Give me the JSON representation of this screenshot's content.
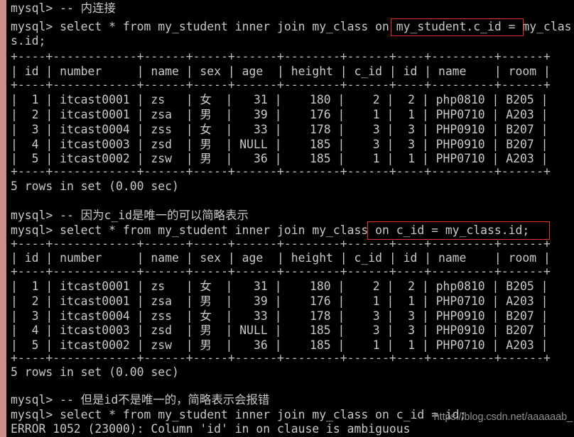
{
  "terminal": {
    "prompt": "mysql>",
    "colors": {
      "background": "#000000",
      "text": "#c9c9c9",
      "gutter": "#cc8e86",
      "highlight_border": "#e8312a",
      "watermark": "#8e8e8e"
    },
    "lines": [
      {
        "id": "l01",
        "text": "mysql> -- 内连接"
      },
      {
        "id": "l02",
        "text": "mysql> select * from my_student inner join my_class on my_student.c_id = my_clas"
      },
      {
        "id": "l03",
        "text": "s.id;"
      },
      {
        "id": "l04",
        "text": "+----+------------+------+-----+------+--------+------+----+---------+------+"
      },
      {
        "id": "l05",
        "text": "| id | number     | name | sex | age  | height | c_id | id | name    | room |"
      },
      {
        "id": "l06",
        "text": "+----+------------+------+-----+------+--------+------+----+---------+------+"
      },
      {
        "id": "l07",
        "text": "|  1 | itcast0001 | zs   | 女  |   31 |    180 |    2 |  2 | php0810 | B205 |"
      },
      {
        "id": "l08",
        "text": "|  2 | itcast0001 | zsa  | 男  |   39 |    176 |    1 |  1 | PHP0710 | A203 |"
      },
      {
        "id": "l09",
        "text": "|  3 | itcast0004 | zss  | 女  |   33 |    178 |    3 |  3 | PHP0910 | B207 |"
      },
      {
        "id": "l10",
        "text": "|  4 | itcast0003 | zsd  | 男  | NULL |    185 |    3 |  3 | PHP0910 | B207 |"
      },
      {
        "id": "l11",
        "text": "|  5 | itcast0002 | zsw  | 男  |   36 |    185 |    1 |  1 | PHP0710 | A203 |"
      },
      {
        "id": "l12",
        "text": "+----+------------+------+-----+------+--------+------+----+---------+------+"
      },
      {
        "id": "l13",
        "text": "5 rows in set (0.00 sec)"
      },
      {
        "id": "l14",
        "text": ""
      },
      {
        "id": "l15",
        "text": "mysql> -- 因为c_id是唯一的可以简略表示"
      },
      {
        "id": "l16",
        "text": "mysql> select * from my_student inner join my_class on c_id = my_class.id;"
      },
      {
        "id": "l17",
        "text": "+----+------------+------+-----+------+--------+------+----+---------+------+"
      },
      {
        "id": "l18",
        "text": "| id | number     | name | sex | age  | height | c_id | id | name    | room |"
      },
      {
        "id": "l19",
        "text": "+----+------------+------+-----+------+--------+------+----+---------+------+"
      },
      {
        "id": "l20",
        "text": "|  1 | itcast0001 | zs   | 女  |   31 |    180 |    2 |  2 | php0810 | B205 |"
      },
      {
        "id": "l21",
        "text": "|  2 | itcast0001 | zsa  | 男  |   39 |    176 |    1 |  1 | PHP0710 | A203 |"
      },
      {
        "id": "l22",
        "text": "|  3 | itcast0004 | zss  | 女  |   33 |    178 |    3 |  3 | PHP0910 | B207 |"
      },
      {
        "id": "l23",
        "text": "|  4 | itcast0003 | zsd  | 男  | NULL |    185 |    3 |  3 | PHP0910 | B207 |"
      },
      {
        "id": "l24",
        "text": "|  5 | itcast0002 | zsw  | 男  |   36 |    185 |    1 |  1 | PHP0710 | A203 |"
      },
      {
        "id": "l25",
        "text": "+----+------------+------+-----+------+--------+------+----+---------+------+"
      },
      {
        "id": "l26",
        "text": "5 rows in set (0.00 sec)"
      },
      {
        "id": "l27",
        "text": ""
      },
      {
        "id": "l28",
        "text": "mysql> -- 但是id不是唯一的，简略表示会报错"
      },
      {
        "id": "l29",
        "text": "mysql> select * from my_student inner join my_class on c_id = id;"
      },
      {
        "id": "l30",
        "text": "ERROR 1052 (23000): Column 'id' in on clause is ambiguous"
      }
    ],
    "highlights": [
      {
        "id": "h1",
        "label": "my_student.c_id"
      },
      {
        "id": "h2",
        "label": "on c_id = my_class.id;"
      }
    ],
    "watermark": "https://blog.csdn.net/aaaaaab_"
  },
  "result_tables": [
    {
      "name": "inner-join-explicit-result",
      "columns": [
        "id",
        "number",
        "name",
        "sex",
        "age",
        "height",
        "c_id",
        "id",
        "name",
        "room"
      ],
      "rows": [
        [
          "1",
          "itcast0001",
          "zs",
          "女",
          "31",
          "180",
          "2",
          "2",
          "php0810",
          "B205"
        ],
        [
          "2",
          "itcast0001",
          "zsa",
          "男",
          "39",
          "176",
          "1",
          "1",
          "PHP0710",
          "A203"
        ],
        [
          "3",
          "itcast0004",
          "zss",
          "女",
          "33",
          "178",
          "3",
          "3",
          "PHP0910",
          "B207"
        ],
        [
          "4",
          "itcast0003",
          "zsd",
          "男",
          "NULL",
          "185",
          "3",
          "3",
          "PHP0910",
          "B207"
        ],
        [
          "5",
          "itcast0002",
          "zsw",
          "男",
          "36",
          "185",
          "1",
          "1",
          "PHP0710",
          "A203"
        ]
      ],
      "status": "5 rows in set (0.00 sec)"
    },
    {
      "name": "inner-join-shorthand-result",
      "columns": [
        "id",
        "number",
        "name",
        "sex",
        "age",
        "height",
        "c_id",
        "id",
        "name",
        "room"
      ],
      "rows": [
        [
          "1",
          "itcast0001",
          "zs",
          "女",
          "31",
          "180",
          "2",
          "2",
          "php0810",
          "B205"
        ],
        [
          "2",
          "itcast0001",
          "zsa",
          "男",
          "39",
          "176",
          "1",
          "1",
          "PHP0710",
          "A203"
        ],
        [
          "3",
          "itcast0004",
          "zss",
          "女",
          "33",
          "178",
          "3",
          "3",
          "PHP0910",
          "B207"
        ],
        [
          "4",
          "itcast0003",
          "zsd",
          "男",
          "NULL",
          "185",
          "3",
          "3",
          "PHP0910",
          "B207"
        ],
        [
          "5",
          "itcast0002",
          "zsw",
          "男",
          "36",
          "185",
          "1",
          "1",
          "PHP0710",
          "A203"
        ]
      ],
      "status": "5 rows in set (0.00 sec)"
    }
  ]
}
